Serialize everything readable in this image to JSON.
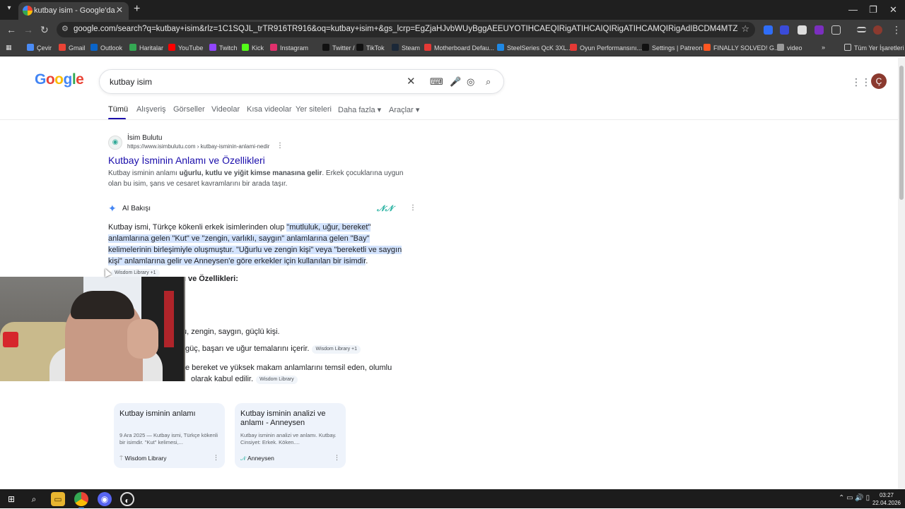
{
  "browser": {
    "tab_title": "kutbay isim - Google'da Ara",
    "url": "google.com/search?q=kutbay+isim&rlz=1C1SQJL_trTR916TR916&oq=kutbay+isim+&gs_lcrp=EgZjaHJvbWUyBggAEEUYOTIHCAEQIRigATIHCAIQIRigATIHCAMQIRigAdIBCDM4MTZqMGo3qAIIsAIB8QUKW_KSpTzsd_EFClvykqU8...",
    "bookmarks": [
      {
        "label": "Çevir",
        "color": "#4a8bf5"
      },
      {
        "label": "Gmail",
        "color": "#ea4335"
      },
      {
        "label": "Outlook",
        "color": "#0a64c8"
      },
      {
        "label": "Haritalar",
        "color": "#34a853"
      },
      {
        "label": "YouTube",
        "color": "#ff0000"
      },
      {
        "label": "Twitch",
        "color": "#9146ff"
      },
      {
        "label": "Kick",
        "color": "#53fc18"
      },
      {
        "label": "Instagram",
        "color": "#e1306c"
      },
      {
        "label": "Twitter / X",
        "color": "#111111"
      },
      {
        "label": "TikTok",
        "color": "#111111"
      },
      {
        "label": "Steam",
        "color": "#1b2838"
      },
      {
        "label": "Motherboard Defau...",
        "color": "#e53935"
      },
      {
        "label": "SteelSeries QcK 3XL...",
        "color": "#1e88e5"
      },
      {
        "label": "Oyun Performansını...",
        "color": "#e53935"
      },
      {
        "label": "Settings | Patreon",
        "color": "#111111"
      },
      {
        "label": "FINALLY SOLVED! G...",
        "color": "#ff5722"
      },
      {
        "label": "video",
        "color": "#999999"
      }
    ],
    "all_bookmarks": "Tüm Yer İşaretleri"
  },
  "google": {
    "logo": "Google",
    "query": "kutbay isim",
    "avatar_letter": "Ç",
    "tabs": [
      "Tümü",
      "Alışveriş",
      "Görseller",
      "Videolar",
      "Kısa videolar",
      "Yer siteleri",
      "Daha fazla ▾",
      "Araçlar ▾"
    ]
  },
  "result": {
    "site_name": "İsim Bulutu",
    "site_url": "https://www.isimbulutu.com › kutbay-isminin-anlami-nedir",
    "title": "Kutbay İsminin Anlamı ve Özellikleri",
    "snippet_pre": "Kutbay isminin anlamı ",
    "snippet_bold": "uğurlu, kutlu ve yiğit kimse manasına gelir",
    "snippet_post": ". Erkek çocuklarına uygun olan bu isim, şans ve cesaret kavramlarını bir arada taşır."
  },
  "ai": {
    "label": "AI Bakışı",
    "intro": "Kutbay ismi, Türkçe kökenli erkek isimlerinden olup ",
    "highlight": "\"mutluluk, uğur, bereket\" anlamlarına gelen \"Kut\" ve \"zengin, varlıklı, saygın\" anlamlarına gelen \"Bay\" kelimelerinin birleşimiyle oluşmuştur. \"Uğurlu ve zengin kişi\" veya \"bereketli ve saygın kişi\" anlamlarına gelir ve Anneysen'e göre erkekler için kullanılan bir isimdir",
    "chip1": "Wisdom Library +1",
    "subheading_visible": "anı ve Özellikleri:",
    "line1": "u, zengin, saygın, güçlü kişi.",
    "line2": "güç, başarı ve uğur temalarını içerir.",
    "chip2": "Wisdom Library +1",
    "line3": "e bereket ve yüksek makam anlamlarını temsil eden, olumlu",
    "line4": "olarak kabul edilir.",
    "chip3": "Wisdom Library"
  },
  "cards": [
    {
      "title": "Kutbay isminin anlamı",
      "snippet": "9 Ara 2025 — Kutbay ismi, Türkçe kökenli bir isimdir. \"Kut\" kelimesi,...",
      "source": "Wisdom Library"
    },
    {
      "title": "Kutbay isminin analizi ve anlamı - Anneysen",
      "snippet": "Kutbay isminin analizi ve anlamı. Kutbay. Cinsiyet: Erkek. Köken....",
      "source": "Anneysen"
    }
  ],
  "taskbar": {
    "time": "03:27",
    "date": "22.04.2026"
  }
}
